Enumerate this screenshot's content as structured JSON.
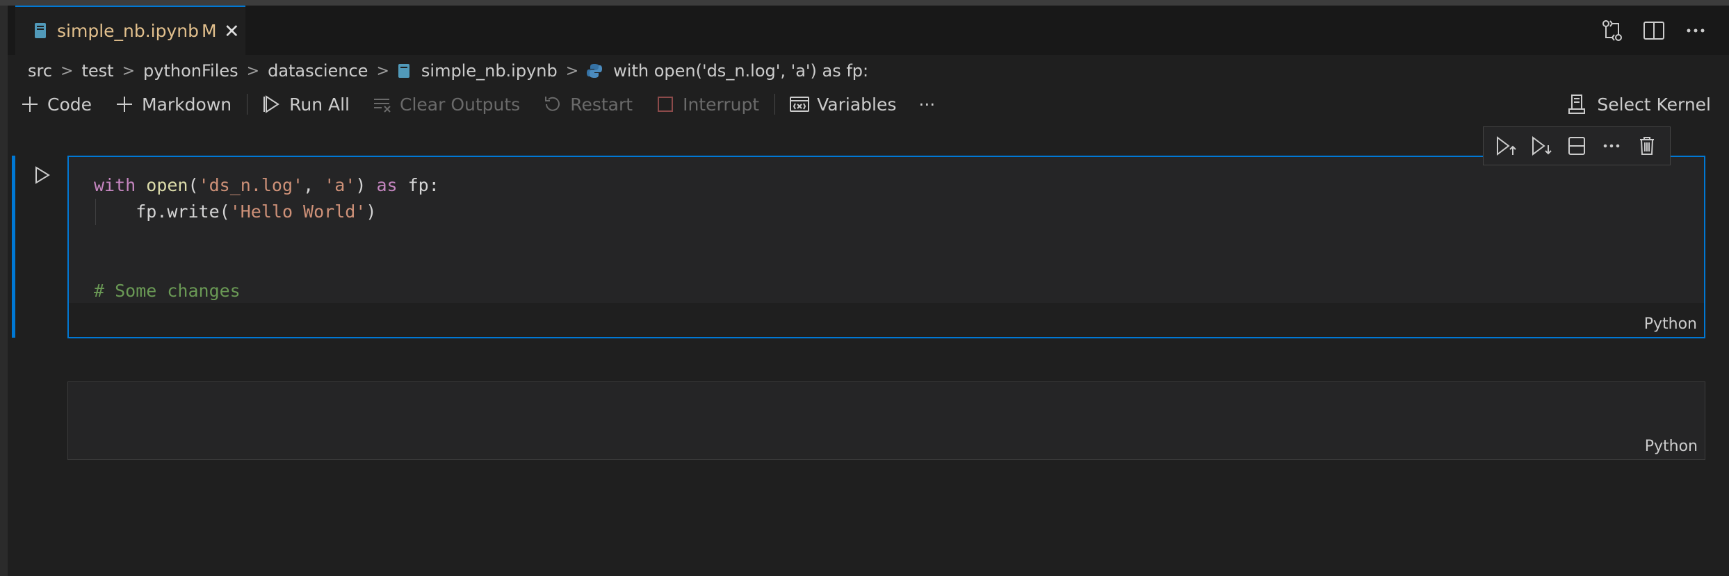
{
  "tab": {
    "title": "simple_nb.ipynb",
    "modified": "M",
    "close": "✕"
  },
  "breadcrumb": [
    "src",
    "test",
    "pythonFiles",
    "datascience",
    "simple_nb.ipynb",
    "with open('ds_n.log', 'a') as fp:"
  ],
  "toolbar": {
    "code": "Code",
    "markdown": "Markdown",
    "run_all": "Run All",
    "clear_outputs": "Clear Outputs",
    "restart": "Restart",
    "interrupt": "Interrupt",
    "variables": "Variables",
    "more": "···"
  },
  "kernel": {
    "label": "Select Kernel"
  },
  "cells": [
    {
      "code": {
        "l1_with": "with",
        "l1_open": "open",
        "l1_p1": "(",
        "l1_s1": "'ds_n.log'",
        "l1_c": ", ",
        "l1_s2": "'a'",
        "l1_p2": ") ",
        "l1_as": "as",
        "l1_fp": " fp:",
        "l2_a": "fp.write(",
        "l2_s": "'Hello World'",
        "l2_b": ")",
        "l5": "# Some changes"
      },
      "language": "Python"
    },
    {
      "code": "",
      "language": "Python"
    }
  ],
  "colors": {
    "accent": "#0078d4",
    "modified": "#e2c08d",
    "keyword": "#c586c0",
    "string": "#ce9178",
    "comment": "#6a9955"
  }
}
